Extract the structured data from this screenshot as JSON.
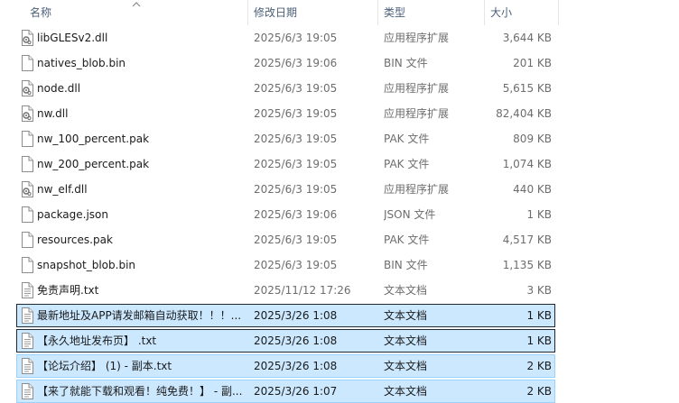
{
  "columns": {
    "name": "名称",
    "date": "修改日期",
    "type": "类型",
    "size": "大小"
  },
  "files": [
    {
      "name": "libGLESv2.dll",
      "date": "2025/6/3 19:05",
      "type": "应用程序扩展",
      "size": "3,644 KB",
      "icon": "dll-file-icon",
      "state": "normal"
    },
    {
      "name": "natives_blob.bin",
      "date": "2025/6/3 19:06",
      "type": "BIN 文件",
      "size": "201 KB",
      "icon": "blank-file-icon",
      "state": "normal"
    },
    {
      "name": "node.dll",
      "date": "2025/6/3 19:05",
      "type": "应用程序扩展",
      "size": "5,615 KB",
      "icon": "dll-file-icon",
      "state": "normal"
    },
    {
      "name": "nw.dll",
      "date": "2025/6/3 19:05",
      "type": "应用程序扩展",
      "size": "82,404 KB",
      "icon": "dll-file-icon",
      "state": "normal"
    },
    {
      "name": "nw_100_percent.pak",
      "date": "2025/6/3 19:05",
      "type": "PAK 文件",
      "size": "809 KB",
      "icon": "blank-file-icon",
      "state": "normal"
    },
    {
      "name": "nw_200_percent.pak",
      "date": "2025/6/3 19:05",
      "type": "PAK 文件",
      "size": "1,074 KB",
      "icon": "blank-file-icon",
      "state": "normal"
    },
    {
      "name": "nw_elf.dll",
      "date": "2025/6/3 19:05",
      "type": "应用程序扩展",
      "size": "440 KB",
      "icon": "dll-file-icon",
      "state": "normal"
    },
    {
      "name": "package.json",
      "date": "2025/6/3 19:06",
      "type": "JSON 文件",
      "size": "1 KB",
      "icon": "blank-file-icon",
      "state": "normal"
    },
    {
      "name": "resources.pak",
      "date": "2025/6/3 19:05",
      "type": "PAK 文件",
      "size": "4,517 KB",
      "icon": "blank-file-icon",
      "state": "normal"
    },
    {
      "name": "snapshot_blob.bin",
      "date": "2025/6/3 19:05",
      "type": "BIN 文件",
      "size": "1,135 KB",
      "icon": "blank-file-icon",
      "state": "normal"
    },
    {
      "name": "免责声明.txt",
      "date": "2025/11/12 17:26",
      "type": "文本文档",
      "size": "3 KB",
      "icon": "text-file-icon",
      "state": "normal"
    },
    {
      "name": "最新地址及APP请发邮箱自动获取！！！...",
      "date": "2025/3/26 1:08",
      "type": "文本文档",
      "size": "1 KB",
      "icon": "text-file-icon",
      "state": "focused"
    },
    {
      "name": "【永久地址发布页】 .txt",
      "date": "2025/3/26 1:08",
      "type": "文本文档",
      "size": "1 KB",
      "icon": "text-file-icon",
      "state": "focused"
    },
    {
      "name": "【论坛介绍】 (1) - 副本.txt",
      "date": "2025/3/26 1:08",
      "type": "文本文档",
      "size": "2 KB",
      "icon": "text-file-icon",
      "state": "selected"
    },
    {
      "name": "【来了就能下载和观看！纯免费！】 - 副...",
      "date": "2025/3/26 1:07",
      "type": "文本文档",
      "size": "2 KB",
      "icon": "text-file-icon",
      "state": "selected"
    }
  ]
}
